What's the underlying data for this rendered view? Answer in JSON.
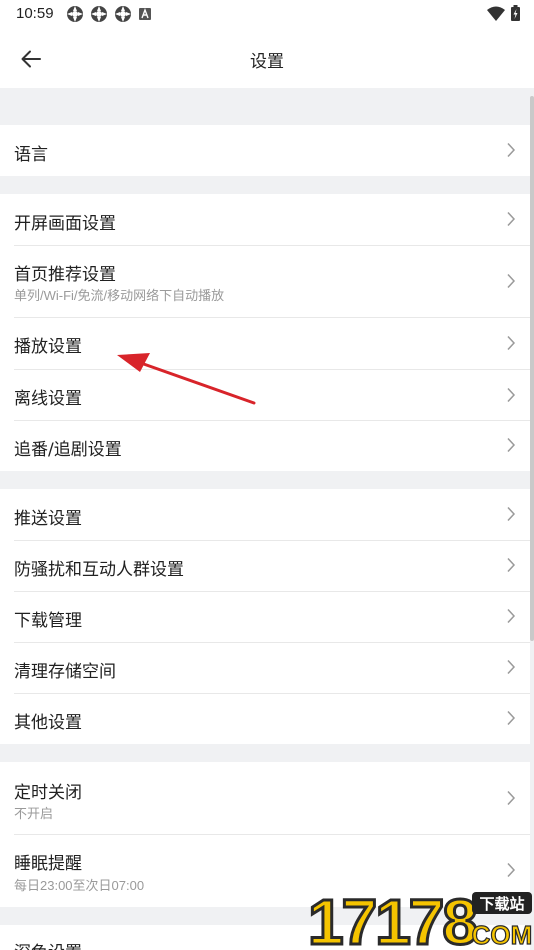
{
  "status_bar": {
    "time": "10:59",
    "icons_left": [
      "app-icon",
      "app-icon",
      "app-icon",
      "a-icon"
    ],
    "icons_right": [
      "wifi-icon",
      "battery-icon"
    ]
  },
  "header": {
    "title": "设置",
    "back_icon": "arrow-left-icon"
  },
  "groups": [
    {
      "items": [
        {
          "label": "语言"
        }
      ]
    },
    {
      "items": [
        {
          "label": "开屏画面设置"
        },
        {
          "label": "首页推荐设置",
          "sublabel": "单列/Wi-Fi/免流/移动网络下自动播放"
        },
        {
          "label": "播放设置"
        },
        {
          "label": "离线设置"
        },
        {
          "label": "追番/追剧设置"
        }
      ]
    },
    {
      "items": [
        {
          "label": "推送设置"
        },
        {
          "label": "防骚扰和互动人群设置"
        },
        {
          "label": "下载管理"
        },
        {
          "label": "清理存储空间"
        },
        {
          "label": "其他设置"
        }
      ]
    },
    {
      "items": [
        {
          "label": "定时关闭",
          "sublabel": "不开启"
        },
        {
          "label": "睡眠提醒",
          "sublabel": "每日23:00至次日07:00"
        }
      ]
    },
    {
      "items": [
        {
          "label": "深色设置"
        }
      ]
    }
  ],
  "watermark": {
    "number": "17178",
    "badge": "下载站",
    "domain": "COM"
  },
  "colors": {
    "background": "#f0f1f3",
    "surface": "#ffffff",
    "text": "#212121",
    "subtext": "#9a9a9a",
    "annotation_arrow": "#d8242a"
  }
}
